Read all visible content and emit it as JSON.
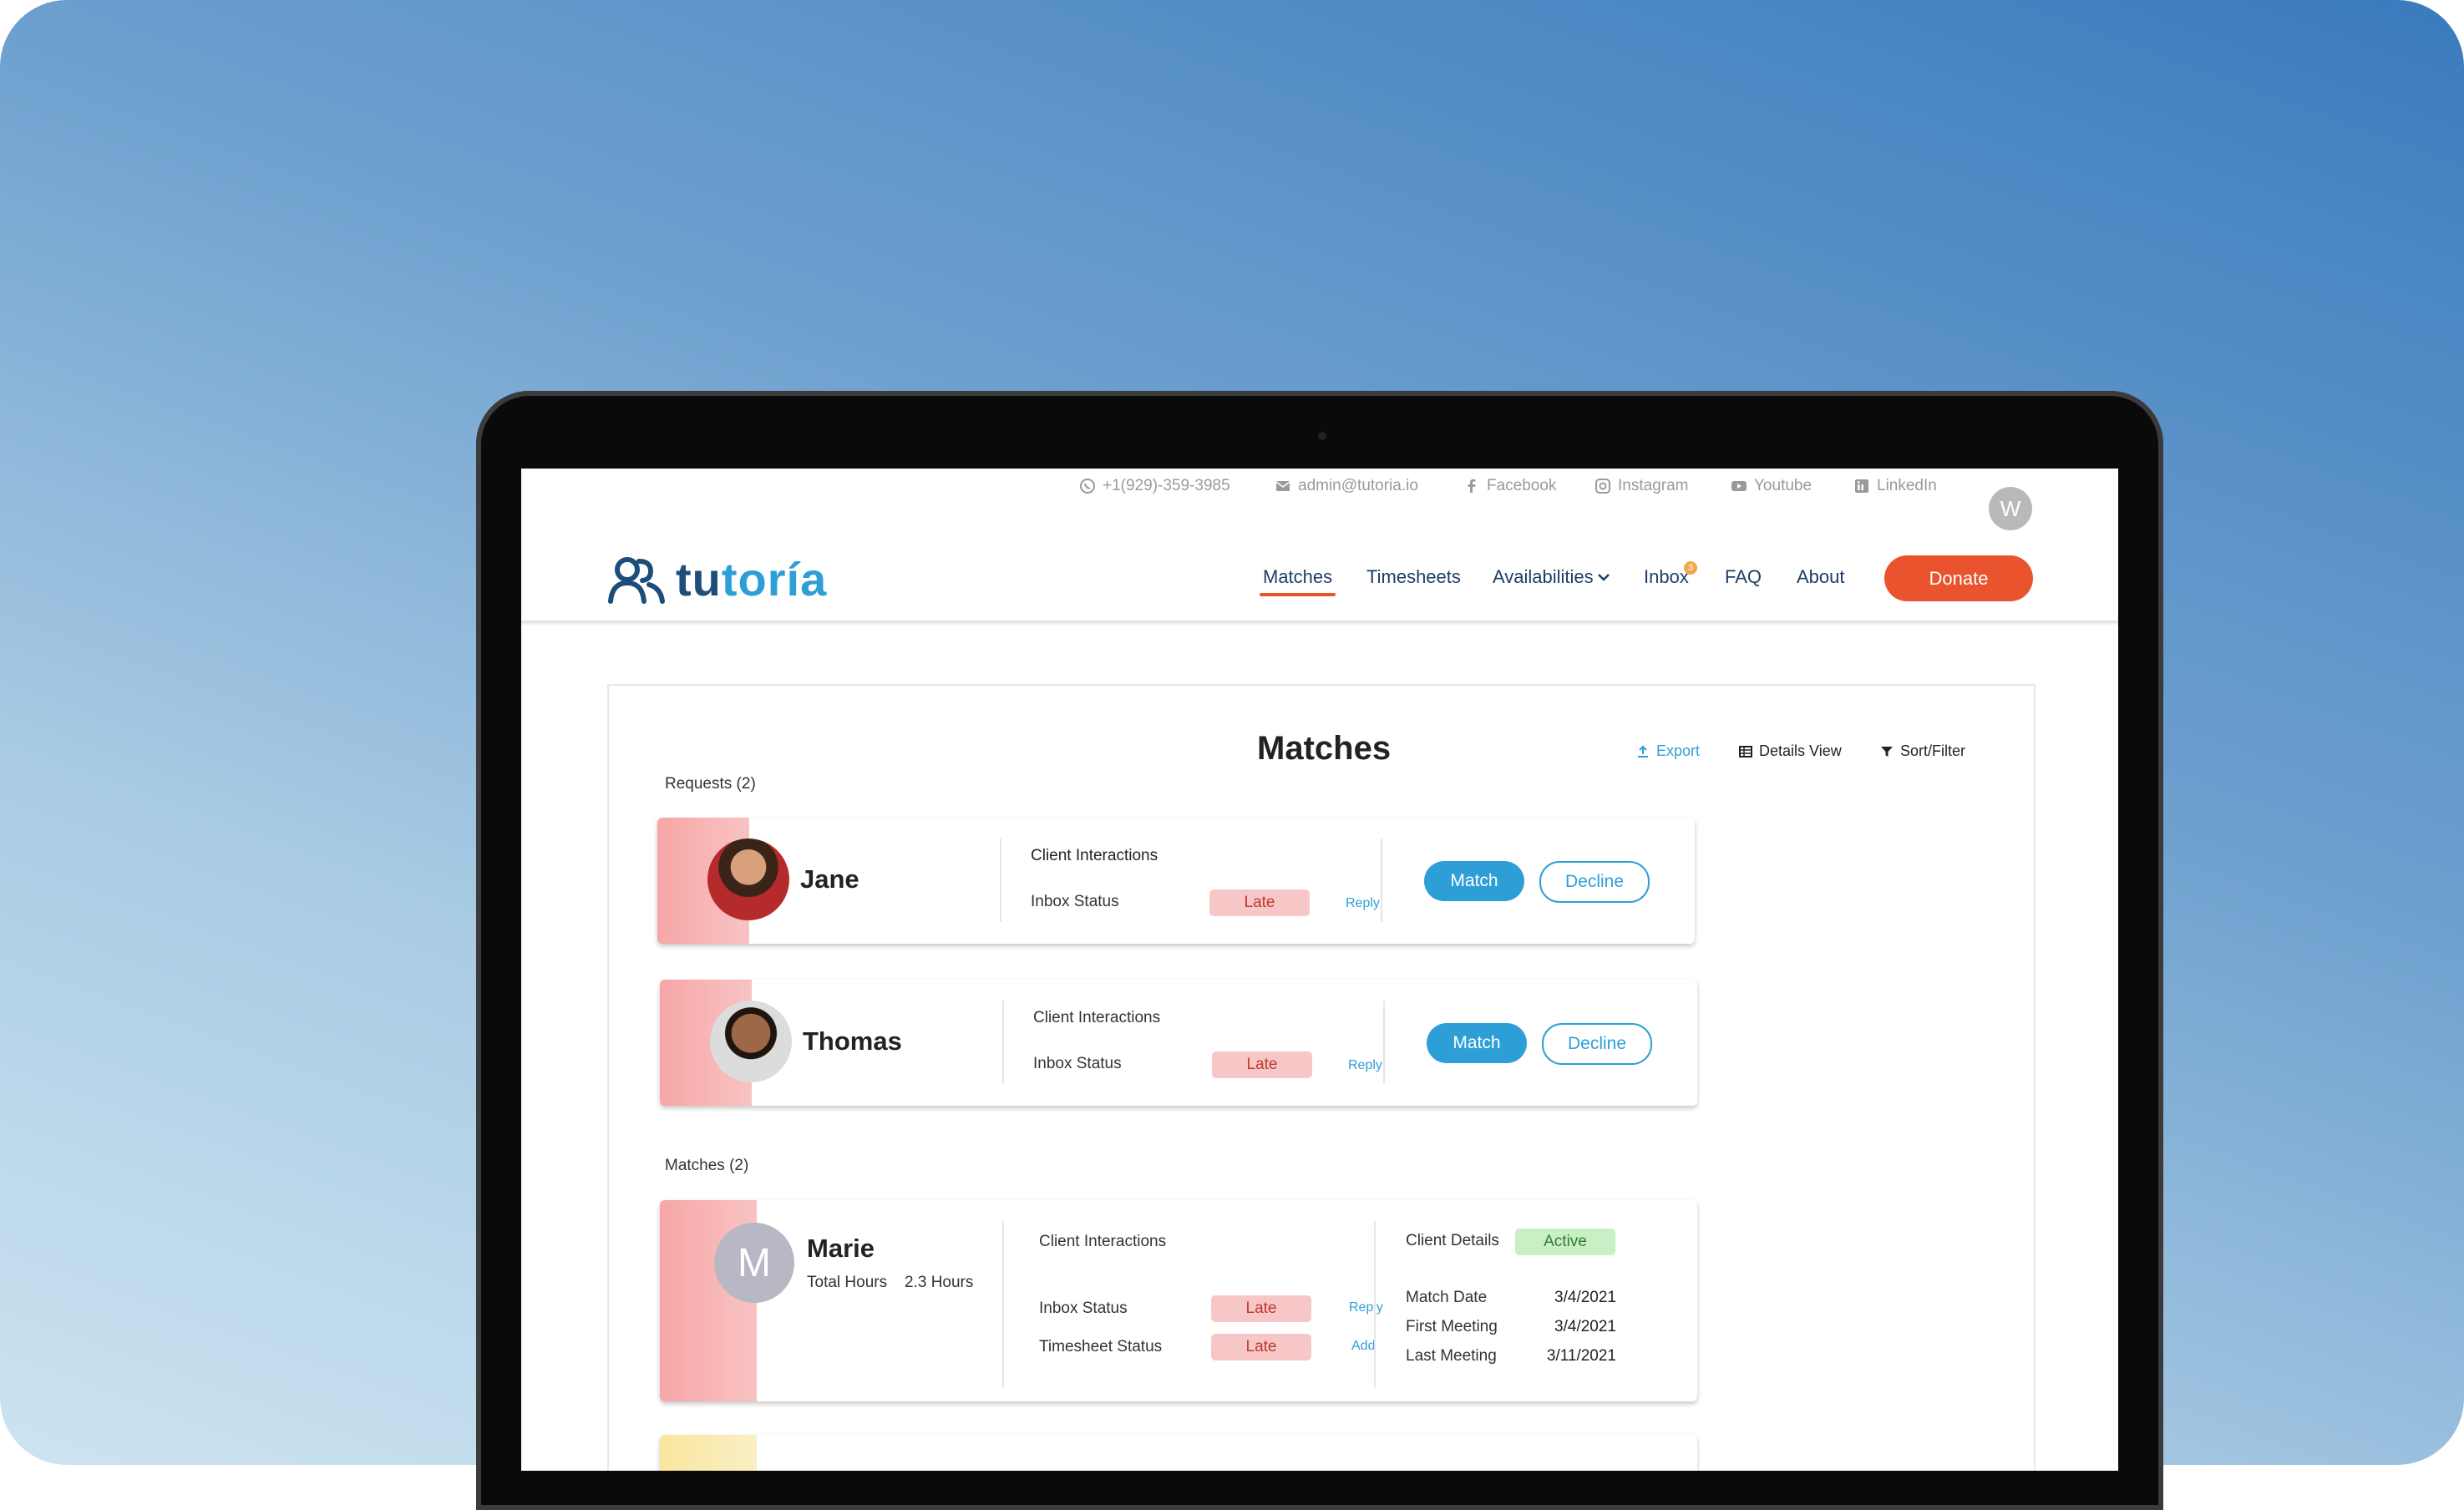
{
  "topbar": {
    "phone": "+1(929)-359-3985",
    "email": "admin@tutoria.io",
    "facebook": "Facebook",
    "instagram": "Instagram",
    "youtube": "Youtube",
    "linkedin": "LinkedIn",
    "avatar_initial": "W"
  },
  "brand": {
    "logo_part1": "tu",
    "logo_part2": "toría"
  },
  "nav": {
    "matches": "Matches",
    "timesheets": "Timesheets",
    "availabilities": "Availabilities",
    "inbox": "Inbox",
    "inbox_badge": "3",
    "faq": "FAQ",
    "about": "About",
    "donate": "Donate"
  },
  "page": {
    "title": "Matches",
    "export": "Export",
    "details_view": "Details View",
    "sort_filter": "Sort/Filter",
    "requests_label": "Requests (2)",
    "matches_label": "Matches (2)"
  },
  "requests": [
    {
      "name": "Jane",
      "client_interactions": "Client Interactions",
      "inbox_status_label": "Inbox Status",
      "inbox_status": "Late",
      "reply": "Reply",
      "match": "Match",
      "decline": "Decline"
    },
    {
      "name": "Thomas",
      "client_interactions": "Client Interactions",
      "inbox_status_label": "Inbox Status",
      "inbox_status": "Late",
      "reply": "Reply",
      "match": "Match",
      "decline": "Decline"
    }
  ],
  "matches": [
    {
      "initial": "M",
      "name": "Marie",
      "total_hours_label": "Total Hours",
      "total_hours": "2.3 Hours",
      "client_interactions": "Client Interactions",
      "inbox_status_label": "Inbox Status",
      "inbox_status": "Late",
      "reply": "Reply",
      "timesheet_status_label": "Timesheet Status",
      "timesheet_status": "Late",
      "add": "Add",
      "client_details": "Client Details",
      "status": "Active",
      "match_date_label": "Match Date",
      "match_date": "3/4/2021",
      "first_meeting_label": "First Meeting",
      "first_meeting": "3/4/2021",
      "last_meeting_label": "Last Meeting",
      "last_meeting": "3/11/2021"
    }
  ]
}
